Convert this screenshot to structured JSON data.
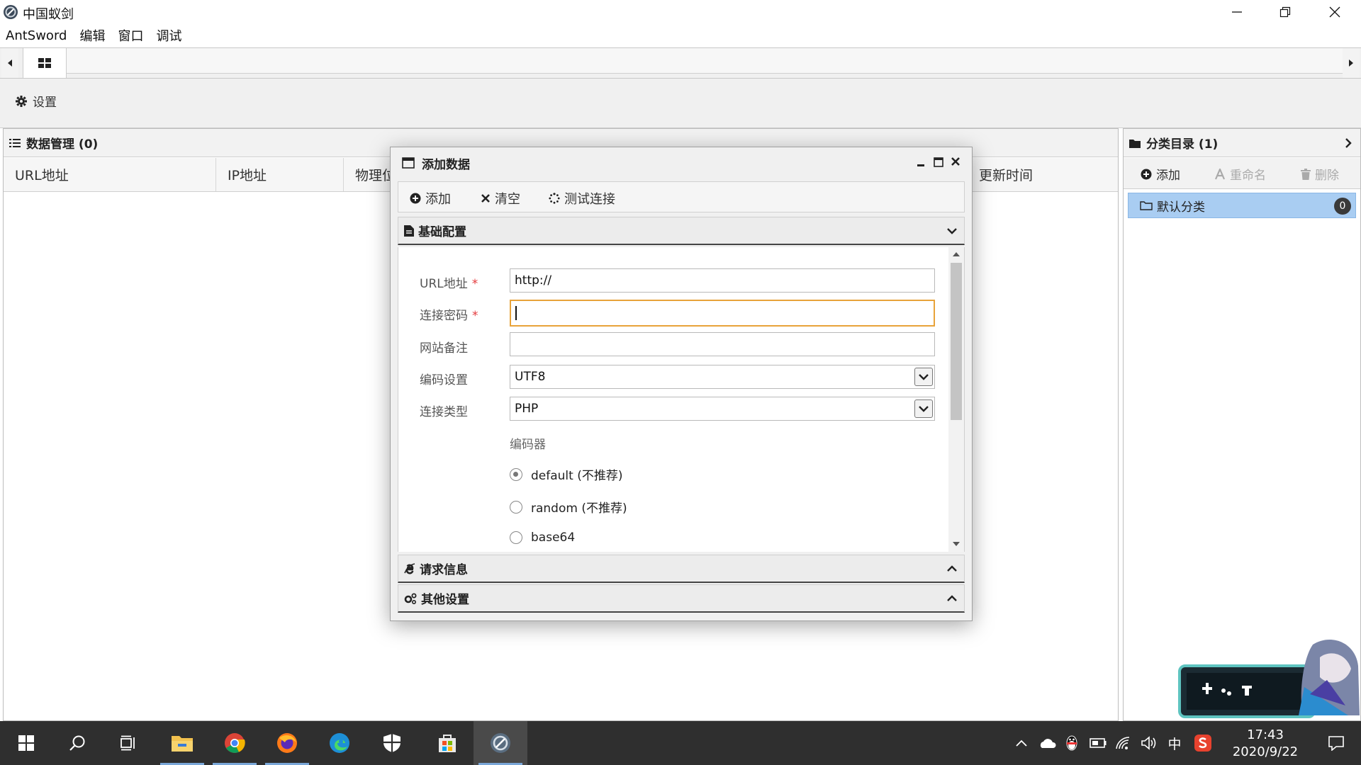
{
  "window": {
    "title": "中国蚁剑"
  },
  "menu": [
    "AntSword",
    "编辑",
    "窗口",
    "调试"
  ],
  "settings": {
    "label": "设置"
  },
  "data_panel": {
    "title": "数据管理 (0)",
    "columns": [
      "URL地址",
      "IP地址",
      "物理位",
      "更新时间"
    ]
  },
  "category_panel": {
    "title": "分类目录 (1)",
    "toolbar": [
      "添加",
      "重命名",
      "删除"
    ],
    "items": [
      {
        "label": "默认分类",
        "count": "0"
      }
    ]
  },
  "dialog": {
    "title": "添加数据",
    "toolbar": {
      "add": "添加",
      "clear": "清空",
      "test": "测试连接"
    },
    "sections": {
      "basic": "基础配置",
      "request": "请求信息",
      "other": "其他设置"
    },
    "form": {
      "url_label": "URL地址",
      "url_value": "http://",
      "password_label": "连接密码",
      "password_value": "",
      "note_label": "网站备注",
      "note_value": "",
      "encoding_label": "编码设置",
      "encoding_value": "UTF8",
      "type_label": "连接类型",
      "type_value": "PHP",
      "encoder_label": "编码器",
      "required_mark": "*",
      "encoders": [
        {
          "label": "default (不推荐)",
          "selected": true
        },
        {
          "label": "random (不推荐)",
          "selected": false
        },
        {
          "label": "base64",
          "selected": false
        }
      ]
    }
  },
  "taskbar": {
    "clock_time": "17:43",
    "clock_date": "2020/9/22",
    "ime": "中"
  },
  "colors": {
    "accent": "#e8a33a",
    "selection": "#a9cdf2",
    "taskbar": "#2f2f2f"
  }
}
